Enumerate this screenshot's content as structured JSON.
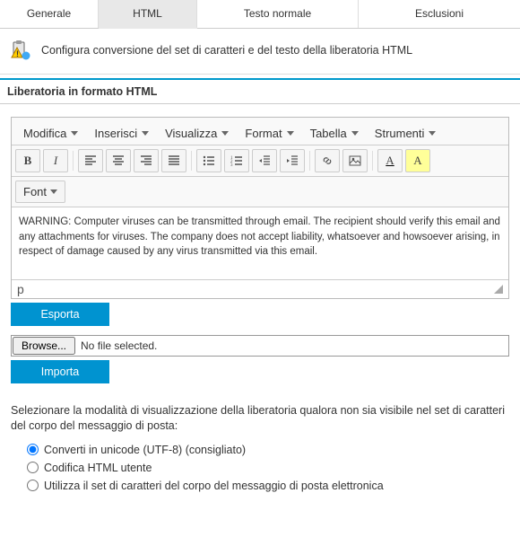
{
  "tabs": {
    "t0": "Generale",
    "t1": "HTML",
    "t2": "Testo normale",
    "t3": "Esclusioni"
  },
  "info": {
    "text": "Configura conversione del set di caratteri e del testo della liberatoria HTML"
  },
  "section": {
    "title": "Liberatoria in formato HTML"
  },
  "menubar": {
    "m0": "Modifica",
    "m1": "Inserisci",
    "m2": "Visualizza",
    "m3": "Format",
    "m4": "Tabella",
    "m5": "Strumenti"
  },
  "font": {
    "label": "Font"
  },
  "editor": {
    "content": "WARNING: Computer viruses can be transmitted through email. The recipient should verify this email and any attachments for viruses. The company does not accept liability, whatsoever and howsoever arising, in respect of damage caused by any virus transmitted via this email."
  },
  "status": {
    "path": "p"
  },
  "actions": {
    "export": "Esporta",
    "import": "Importa"
  },
  "file": {
    "browse": "Browse...",
    "status": "No file selected."
  },
  "help": {
    "text": "Selezionare la modalità di visualizzazione della liberatoria qualora non sia visibile nel set di caratteri del corpo del messaggio di posta:"
  },
  "radios": {
    "r0": "Converti in unicode (UTF-8) (consigliato)",
    "r1": "Codifica HTML utente",
    "r2": "Utilizza il set di caratteri del corpo del messaggio di posta elettronica"
  }
}
